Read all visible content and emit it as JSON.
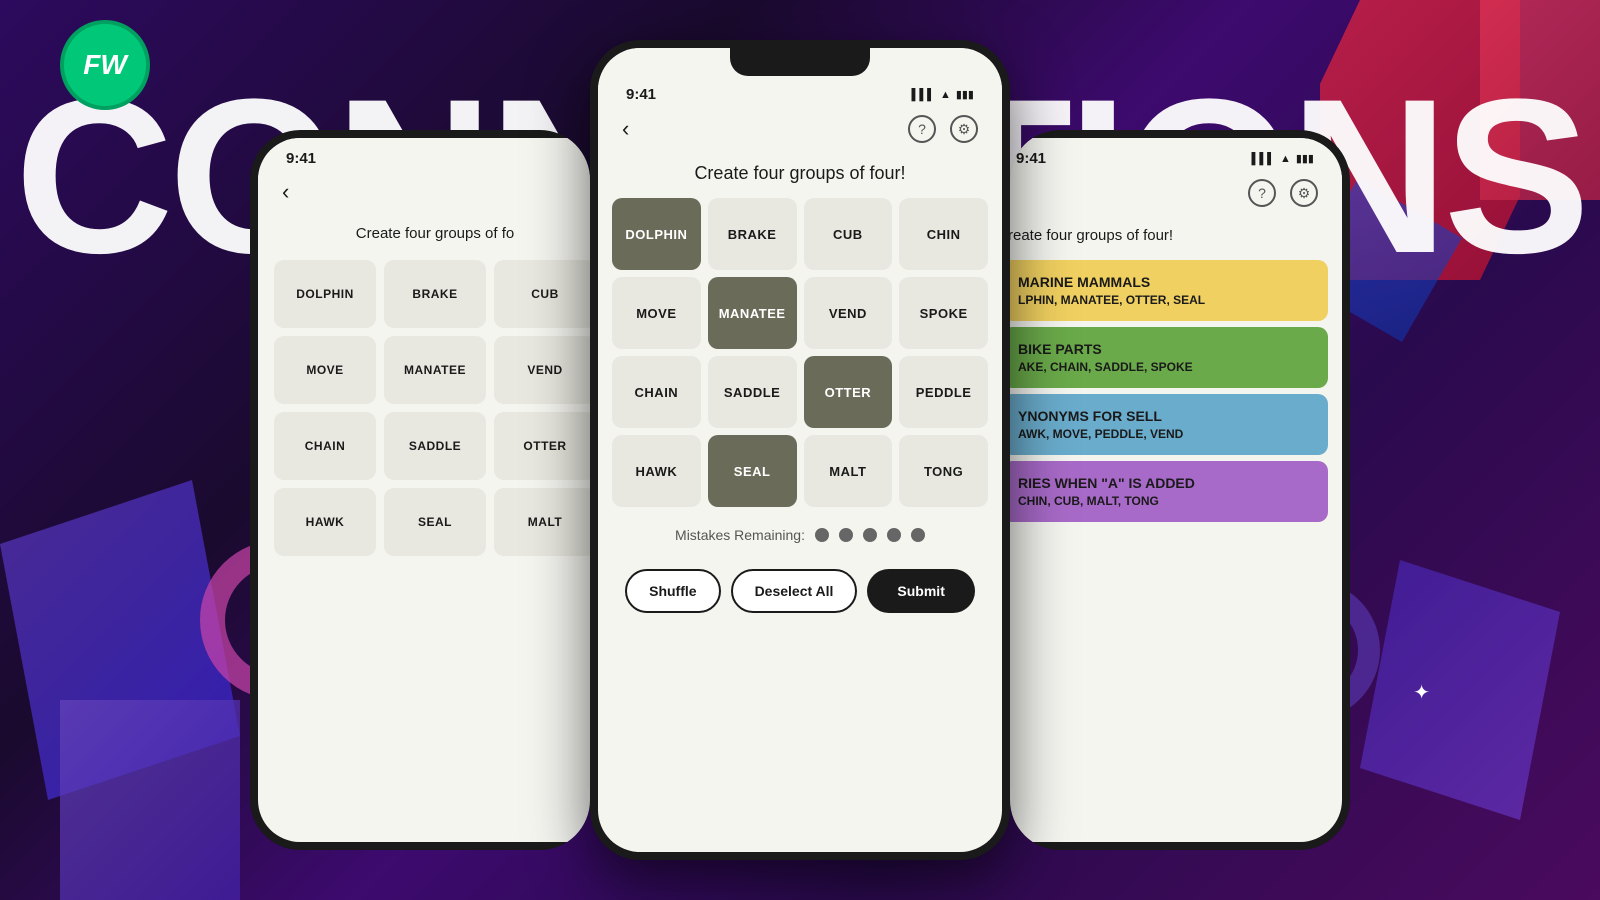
{
  "background": {
    "title": "Connections"
  },
  "logo": {
    "text": "FW"
  },
  "phone_left": {
    "status_time": "9:41",
    "nav_back": "‹",
    "subtitle": "Create four groups of fo",
    "grid": [
      {
        "word": "DOLPHIN",
        "selected": false
      },
      {
        "word": "BRAKE",
        "selected": false
      },
      {
        "word": "CUB",
        "selected": false
      },
      {
        "word": "MOVE",
        "selected": false
      },
      {
        "word": "MANATEE",
        "selected": false
      },
      {
        "word": "VEND",
        "selected": false
      },
      {
        "word": "CHAIN",
        "selected": false
      },
      {
        "word": "SADDLE",
        "selected": false
      },
      {
        "word": "OTTER",
        "selected": false
      },
      {
        "word": "HAWK",
        "selected": false
      },
      {
        "word": "SEAL",
        "selected": false
      },
      {
        "word": "MALT",
        "selected": false
      }
    ]
  },
  "phone_center": {
    "status_time": "9:41",
    "nav_back": "‹",
    "subtitle": "Create four groups of four!",
    "grid": [
      {
        "word": "DOLPHIN",
        "selected": true
      },
      {
        "word": "BRAKE",
        "selected": false
      },
      {
        "word": "CUB",
        "selected": false
      },
      {
        "word": "CHIN",
        "selected": false
      },
      {
        "word": "MOVE",
        "selected": false
      },
      {
        "word": "MANATEE",
        "selected": true
      },
      {
        "word": "VEND",
        "selected": false
      },
      {
        "word": "SPOKE",
        "selected": false
      },
      {
        "word": "CHAIN",
        "selected": false
      },
      {
        "word": "SADDLE",
        "selected": false
      },
      {
        "word": "OTTER",
        "selected": true
      },
      {
        "word": "PEDDLE",
        "selected": false
      },
      {
        "word": "HAWK",
        "selected": false
      },
      {
        "word": "SEAL",
        "selected": true
      },
      {
        "word": "MALT",
        "selected": false
      },
      {
        "word": "TONG",
        "selected": false
      }
    ],
    "mistakes_label": "Mistakes Remaining:",
    "dots": 5,
    "btn_shuffle": "Shuffle",
    "btn_deselect": "Deselect All",
    "btn_submit": "Submit"
  },
  "phone_right": {
    "status_time": "9:41",
    "subtitle": "reate four groups of four!",
    "categories": [
      {
        "color": "yellow",
        "title": "MARINE MAMMALS",
        "words": "LPHIN, MANATEE, OTTER, SEAL"
      },
      {
        "color": "green",
        "title": "BIKE PARTS",
        "words": "AKE, CHAIN, SADDLE, SPOKE"
      },
      {
        "color": "blue",
        "title": "SYNONYMS FOR SELL",
        "words": "AWK, MOVE, PEDDLE, VEND"
      },
      {
        "color": "purple",
        "title": "RIES WHEN \"A\" IS ADDED",
        "words": "CHIN, CUB, MALT, TONG"
      }
    ]
  }
}
